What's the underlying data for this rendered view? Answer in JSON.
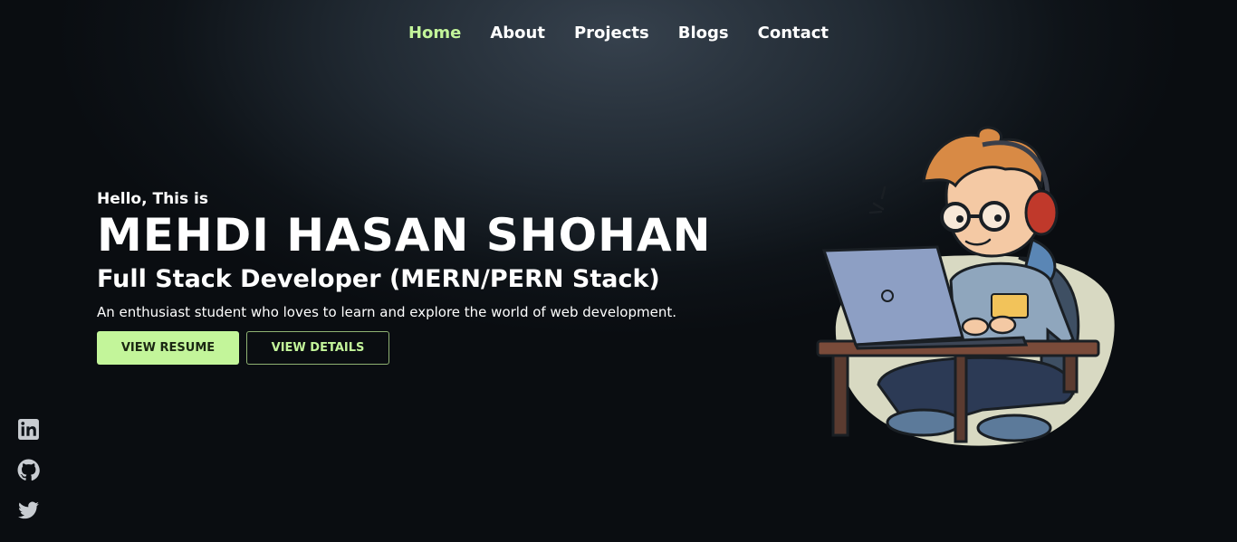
{
  "nav": {
    "items": [
      {
        "label": "Home",
        "active": true
      },
      {
        "label": "About"
      },
      {
        "label": "Projects"
      },
      {
        "label": "Blogs"
      },
      {
        "label": "Contact"
      }
    ]
  },
  "hero": {
    "greeting": "Hello, This is",
    "name": "MEHDI HASAN SHOHAN",
    "role": "Full Stack Developer (MERN/PERN Stack)",
    "description": "An enthusiast student who loves to learn and explore the world of web development.",
    "primary_button": "VIEW RESUME",
    "secondary_button": "VIEW DETAILS"
  },
  "socials": [
    "linkedin-icon",
    "github-icon",
    "twitter-icon"
  ],
  "colors": {
    "accent": "#c3f59a",
    "background": "#0e1318",
    "text": "#ffffff"
  }
}
